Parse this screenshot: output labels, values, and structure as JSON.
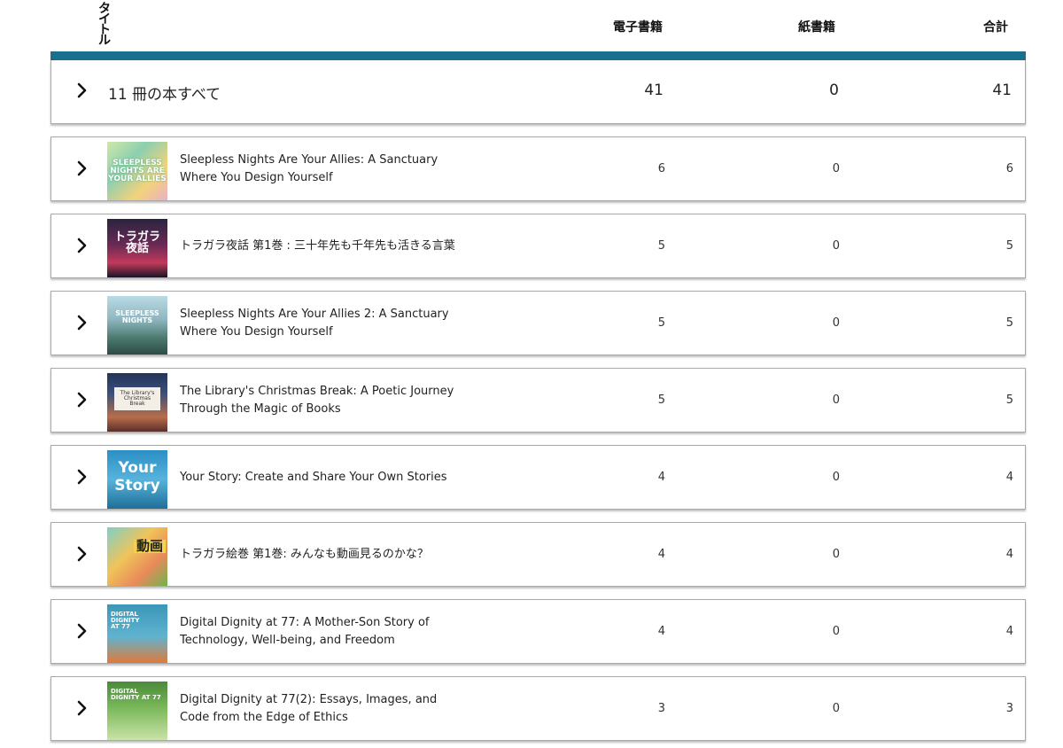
{
  "header": {
    "title_label": "タイトル",
    "ebook_label": "電子書籍",
    "paper_label": "紙書籍",
    "total_label": "合計"
  },
  "summary": {
    "label": "11 冊の本すべて",
    "ebook": "41",
    "paper": "0",
    "total": "41"
  },
  "books": [
    {
      "title": "Sleepless Nights Are Your Allies: A Sanctuary Where You Design Yourself",
      "ebook": "6",
      "paper": "0",
      "total": "6",
      "cover_text": "SLEEPLESS NIGHTS ARE YOUR ALLIES"
    },
    {
      "title": "トラガラ夜話 第1巻 : 三十年先も千年先も活きる言葉",
      "ebook": "5",
      "paper": "0",
      "total": "5",
      "cover_text": "トラガラ 夜話"
    },
    {
      "title": "Sleepless Nights Are Your Allies 2: A Sanctuary Where You Design Yourself",
      "ebook": "5",
      "paper": "0",
      "total": "5",
      "cover_text": "SLEEPLESS NIGHTS"
    },
    {
      "title": "The Library's Christmas Break: A Poetic Journey Through the Magic of Books",
      "ebook": "5",
      "paper": "0",
      "total": "5",
      "cover_text": "The Library's Christmas Break"
    },
    {
      "title": "Your Story: Create and Share Your Own Stories",
      "ebook": "4",
      "paper": "0",
      "total": "4",
      "cover_text": "Your Story"
    },
    {
      "title": "トラガラ絵巻 第1巻: みんなも動画見るのかな？",
      "ebook": "4",
      "paper": "0",
      "total": "4",
      "cover_text": "動画"
    },
    {
      "title": "Digital Dignity at 77: A Mother-Son Story of Technology, Well-being, and Freedom",
      "ebook": "4",
      "paper": "0",
      "total": "4",
      "cover_text": "DIGITAL DIGNITY AT 77"
    },
    {
      "title": "Digital Dignity at 77(2): Essays, Images, and Code from the Edge of Ethics",
      "ebook": "3",
      "paper": "0",
      "total": "3",
      "cover_text": "DIGITAL DIGNITY AT 77"
    }
  ]
}
